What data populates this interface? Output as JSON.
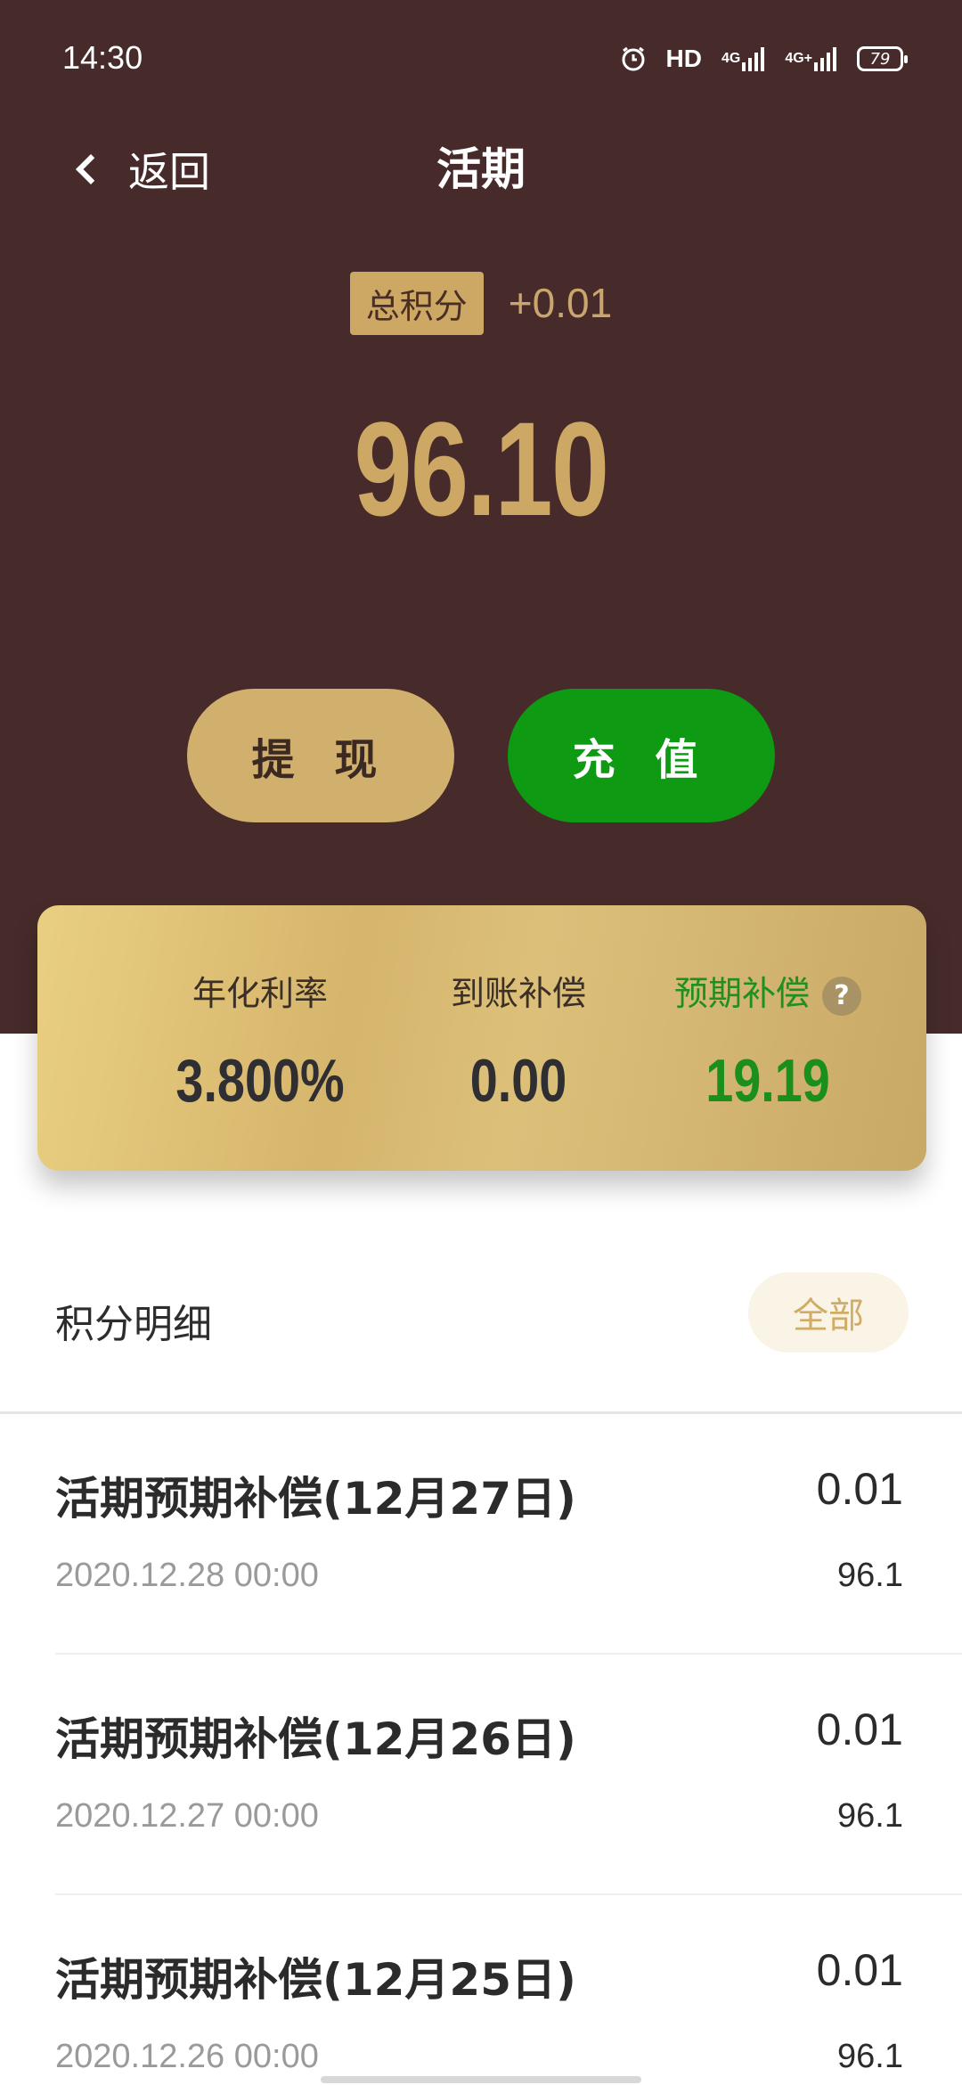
{
  "status_bar": {
    "time": "14:30",
    "icons": [
      "alarm-icon",
      "hd-icon",
      "signal-4g-icon",
      "signal-4g-icon",
      "battery-icon"
    ],
    "hd_label": "HD",
    "net1": "4G",
    "net2": "4G+",
    "battery": "79"
  },
  "nav": {
    "back_label": "返回",
    "title": "活期"
  },
  "summary": {
    "total_label": "总积分",
    "delta": "+0.01",
    "total_value": "96.10"
  },
  "actions": {
    "withdraw": "提 现",
    "recharge": "充 值"
  },
  "stats": [
    {
      "label": "年化利率",
      "value": "3.800%"
    },
    {
      "label": "到账补偿",
      "value": "0.00"
    },
    {
      "label": "预期补偿",
      "value": "19.19",
      "help": "?"
    }
  ],
  "details": {
    "title": "积分明细",
    "filter": "全部",
    "items": [
      {
        "title": "活期预期补偿(12月27日)",
        "amount": "0.01",
        "date": "2020.12.28 00:00",
        "balance": "96.1"
      },
      {
        "title": "活期预期补偿(12月26日)",
        "amount": "0.01",
        "date": "2020.12.27 00:00",
        "balance": "96.1"
      },
      {
        "title": "活期预期补偿(12月25日)",
        "amount": "0.01",
        "date": "2020.12.26 00:00",
        "balance": "96.1"
      }
    ]
  },
  "colors": {
    "header_bg": "#472b2b",
    "gold": "#cda864",
    "green": "#0e9a12"
  }
}
